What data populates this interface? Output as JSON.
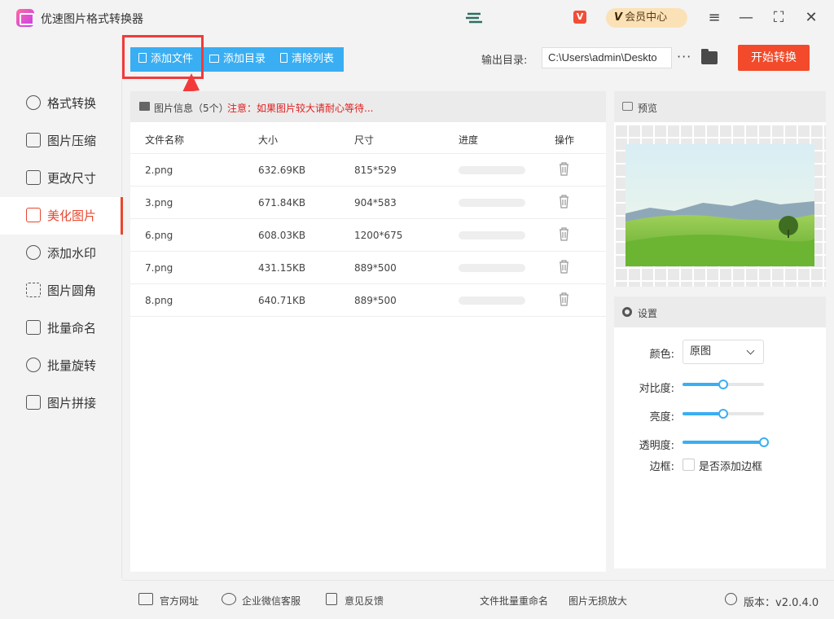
{
  "app": {
    "title": "优速图片格式转换器"
  },
  "titlebar": {
    "user_name": "",
    "vip_label": "会员中心",
    "vip_icon": "V",
    "v_badge": "V"
  },
  "sidebar": {
    "items": [
      {
        "label": "格式转换",
        "icon": "format-convert-icon"
      },
      {
        "label": "图片压缩",
        "icon": "compress-icon"
      },
      {
        "label": "更改尺寸",
        "icon": "resize-icon"
      },
      {
        "label": "美化图片",
        "icon": "beautify-icon",
        "active": true
      },
      {
        "label": "添加水印",
        "icon": "watermark-icon"
      },
      {
        "label": "图片圆角",
        "icon": "round-corner-icon"
      },
      {
        "label": "批量命名",
        "icon": "rename-icon"
      },
      {
        "label": "批量旋转",
        "icon": "rotate-icon"
      },
      {
        "label": "图片拼接",
        "icon": "stitch-icon"
      }
    ]
  },
  "toolbar": {
    "add_file": "添加文件",
    "add_folder": "添加目录",
    "clear_list": "清除列表",
    "output_label": "输出目录:",
    "output_path": "C:\\Users\\admin\\Deskto",
    "more": "···",
    "start": "开始转换"
  },
  "file_panel": {
    "title": "图片信息（5个）",
    "warning": "注意：如果图片较大请耐心等待...",
    "columns": [
      "文件名称",
      "大小",
      "尺寸",
      "进度",
      "操作"
    ],
    "rows": [
      {
        "name": "2.png",
        "size": "632.69KB",
        "dims": "815*529",
        "progress": 0
      },
      {
        "name": "3.png",
        "size": "671.84KB",
        "dims": "904*583",
        "progress": 0
      },
      {
        "name": "6.png",
        "size": "608.03KB",
        "dims": "1200*675",
        "progress": 0
      },
      {
        "name": "7.png",
        "size": "431.15KB",
        "dims": "889*500",
        "progress": 0
      },
      {
        "name": "8.png",
        "size": "640.71KB",
        "dims": "889*500",
        "progress": 0
      }
    ]
  },
  "preview": {
    "title": "预览"
  },
  "settings": {
    "title": "设置",
    "color_label": "颜色:",
    "color_value": "原图",
    "contrast_label": "对比度:",
    "contrast_value": 0.5,
    "brightness_label": "亮度:",
    "brightness_value": 0.5,
    "opacity_label": "透明度:",
    "opacity_value": 1.0,
    "border_label": "边框:",
    "border_check_label": "是否添加边框"
  },
  "footer": {
    "website": "官方网址",
    "wechat": "企业微信客服",
    "feedback": "意见反馈",
    "batch_rename": "文件批量重命名",
    "lossless": "图片无损放大",
    "version": "版本：v2.0.4.0"
  },
  "colors": {
    "accent": "#3aaef2",
    "active": "#e8472e",
    "start": "#f24a2a"
  }
}
